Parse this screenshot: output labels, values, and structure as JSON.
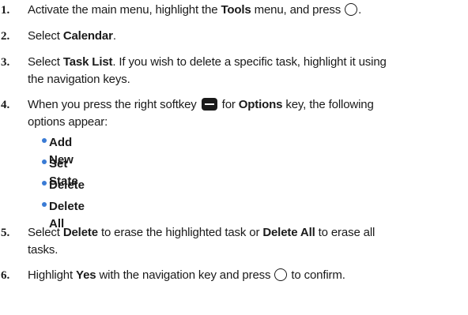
{
  "steps": [
    {
      "num": "1.",
      "t1": "Activate the main menu, highlight the ",
      "b1": "Tools",
      "t2": " menu, and press ",
      "t3": "."
    },
    {
      "num": "2.",
      "t1": "Select ",
      "b1": "Calendar",
      "t2": "."
    },
    {
      "num": "3.",
      "t1": "Select ",
      "b1": "Task List",
      "t2": ". If you wish to delete a specific task, highlight it using",
      "line2": "the navigation keys."
    },
    {
      "num": "4.",
      "t1": "When you press the right softkey ",
      "t2": " for ",
      "b1": "Options",
      "t3": " key, the following",
      "line2": "options appear:"
    },
    {
      "num": "5.",
      "t1": "Select ",
      "b1": "Delete",
      "t2": " to erase the highlighted task or ",
      "b2": "Delete All",
      "t3": " to erase all",
      "line2": "tasks."
    },
    {
      "num": "6.",
      "t1": "Highlight ",
      "b1": "Yes",
      "t2": " with the navigation key and press ",
      "t3": " to confirm."
    }
  ],
  "options": [
    "Add New",
    "Set State",
    "Delete",
    "Delete All"
  ],
  "icons": {
    "select_key": "circle-key-icon",
    "softkey": "right-softkey-icon"
  },
  "colors": {
    "bullet": "#3a7bd5",
    "text": "#1a1a1a"
  }
}
